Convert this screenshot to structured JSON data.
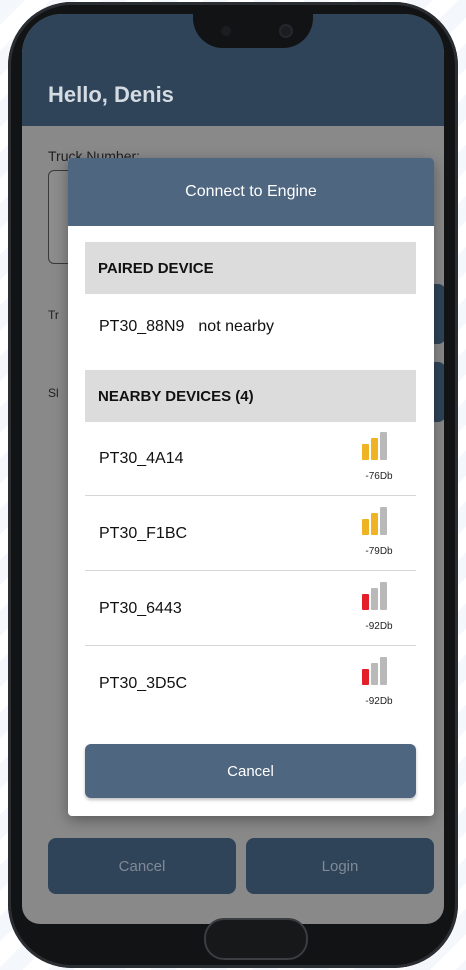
{
  "app": {
    "greeting": "Hello, Denis",
    "truck_number_label": "Truck Number:",
    "partial_label_1": "Tr",
    "partial_label_2": "Sl",
    "cancel_label": "Cancel",
    "login_label": "Login"
  },
  "modal": {
    "title": "Connect to Engine",
    "paired_section": "PAIRED DEVICE",
    "paired_device": {
      "name": "PT30_88N9",
      "status": "not nearby"
    },
    "nearby_section": "NEARBY DEVICES (4)",
    "nearby_devices": [
      {
        "name": "PT30_4A14",
        "signal": "-76Db",
        "level": 2,
        "color": "#f0b323"
      },
      {
        "name": "PT30_F1BC",
        "signal": "-79Db",
        "level": 2,
        "color": "#f0b323"
      },
      {
        "name": "PT30_6443",
        "signal": "-92Db",
        "level": 1,
        "color": "#e3202a"
      },
      {
        "name": "PT30_3D5C",
        "signal": "-92Db",
        "level": 1,
        "color": "#e3202a"
      }
    ],
    "cancel_label": "Cancel"
  },
  "colors": {
    "header": "#2f4459",
    "modal_header": "#4f6680",
    "signal_inactive": "#b9b9b9"
  }
}
